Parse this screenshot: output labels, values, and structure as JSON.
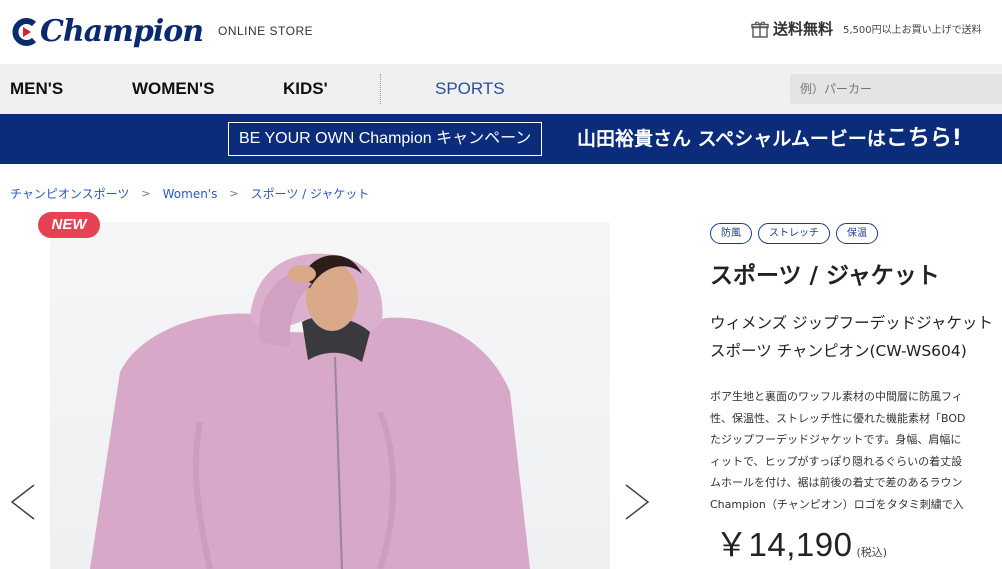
{
  "header": {
    "logo_text": "Champion",
    "store_label": "ONLINE STORE",
    "shipping_title": "送料無料",
    "shipping_note": "5,500円以上お買い上げで送料"
  },
  "nav": {
    "items": [
      "MEN'S",
      "WOMEN'S",
      "KIDS'",
      "SPORTS"
    ],
    "search_placeholder": "例）パーカー"
  },
  "banner": {
    "campaign": "BE YOUR OWN Champion キャンペーン",
    "movie_prefix": "山田裕貴さん スペシャルムービーは",
    "movie_emphasis": "こちら!"
  },
  "breadcrumb": [
    "チャンピオンスポーツ",
    "Women's",
    "スポーツ / ジャケット"
  ],
  "breadcrumb_separator": ">",
  "product": {
    "badge": "NEW",
    "tags": [
      "防風",
      "ストレッチ",
      "保温"
    ],
    "category": "スポーツ / ジャケット",
    "name_lines": [
      "ウィメンズ ジップフーデッドジャケット",
      "スポーツ チャンピオン(CW-WS604)"
    ],
    "description_lines": [
      "ボア生地と裏面のワッフル素材の中間層に防風フィ",
      "性、保温性、ストレッチ性に優れた機能素材「BOD",
      "たジップフーデッドジャケットです。身幅、肩幅に",
      "ィットで、ヒップがすっぽり隠れるぐらいの着丈設",
      "ムホールを付け、裾は前後の着丈で差のあるラウン",
      "Champion（チャンピオン）ロゴをタタミ刺繍で入"
    ],
    "price": "￥14,190",
    "tax_label": "(税込)"
  },
  "colors": {
    "brand_navy": "#0a2c7a",
    "logo_red": "#d6202a",
    "badge_red": "#e64253",
    "link_blue": "#2a5ab8",
    "jacket_pink": "#d7a8c8"
  }
}
